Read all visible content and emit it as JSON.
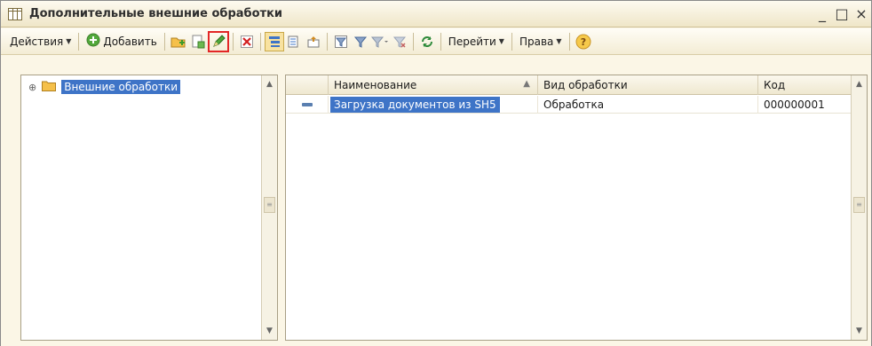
{
  "window": {
    "title": "Дополнительные внешние обработки",
    "controls": {
      "minimize": "_",
      "maximize": "□",
      "close": "×"
    }
  },
  "toolbar": {
    "actions_label": "Действия",
    "add_label": "Добавить",
    "goto_label": "Перейти",
    "rights_label": "Права",
    "icons": [
      "new-folder-icon",
      "copy-icon",
      "edit-icon",
      "delete-icon",
      "hierarchy-icon",
      "list-icon",
      "move-to-group-icon",
      "filter-by-value-icon",
      "filter-icon",
      "filter-list-icon",
      "clear-filter-icon",
      "refresh-icon",
      "help-icon"
    ]
  },
  "tree": {
    "items": [
      {
        "label": "Внешние обработки",
        "expand": "⊕"
      }
    ]
  },
  "table": {
    "columns": [
      "Наименование",
      "Вид обработки",
      "Код"
    ],
    "rows": [
      {
        "name": "Загрузка документов из SH5",
        "type": "Обработка",
        "code": "000000001"
      }
    ]
  },
  "colors": {
    "selection": "#3e74c7",
    "highlight_border": "#e32626",
    "background": "#fbf6e6"
  }
}
